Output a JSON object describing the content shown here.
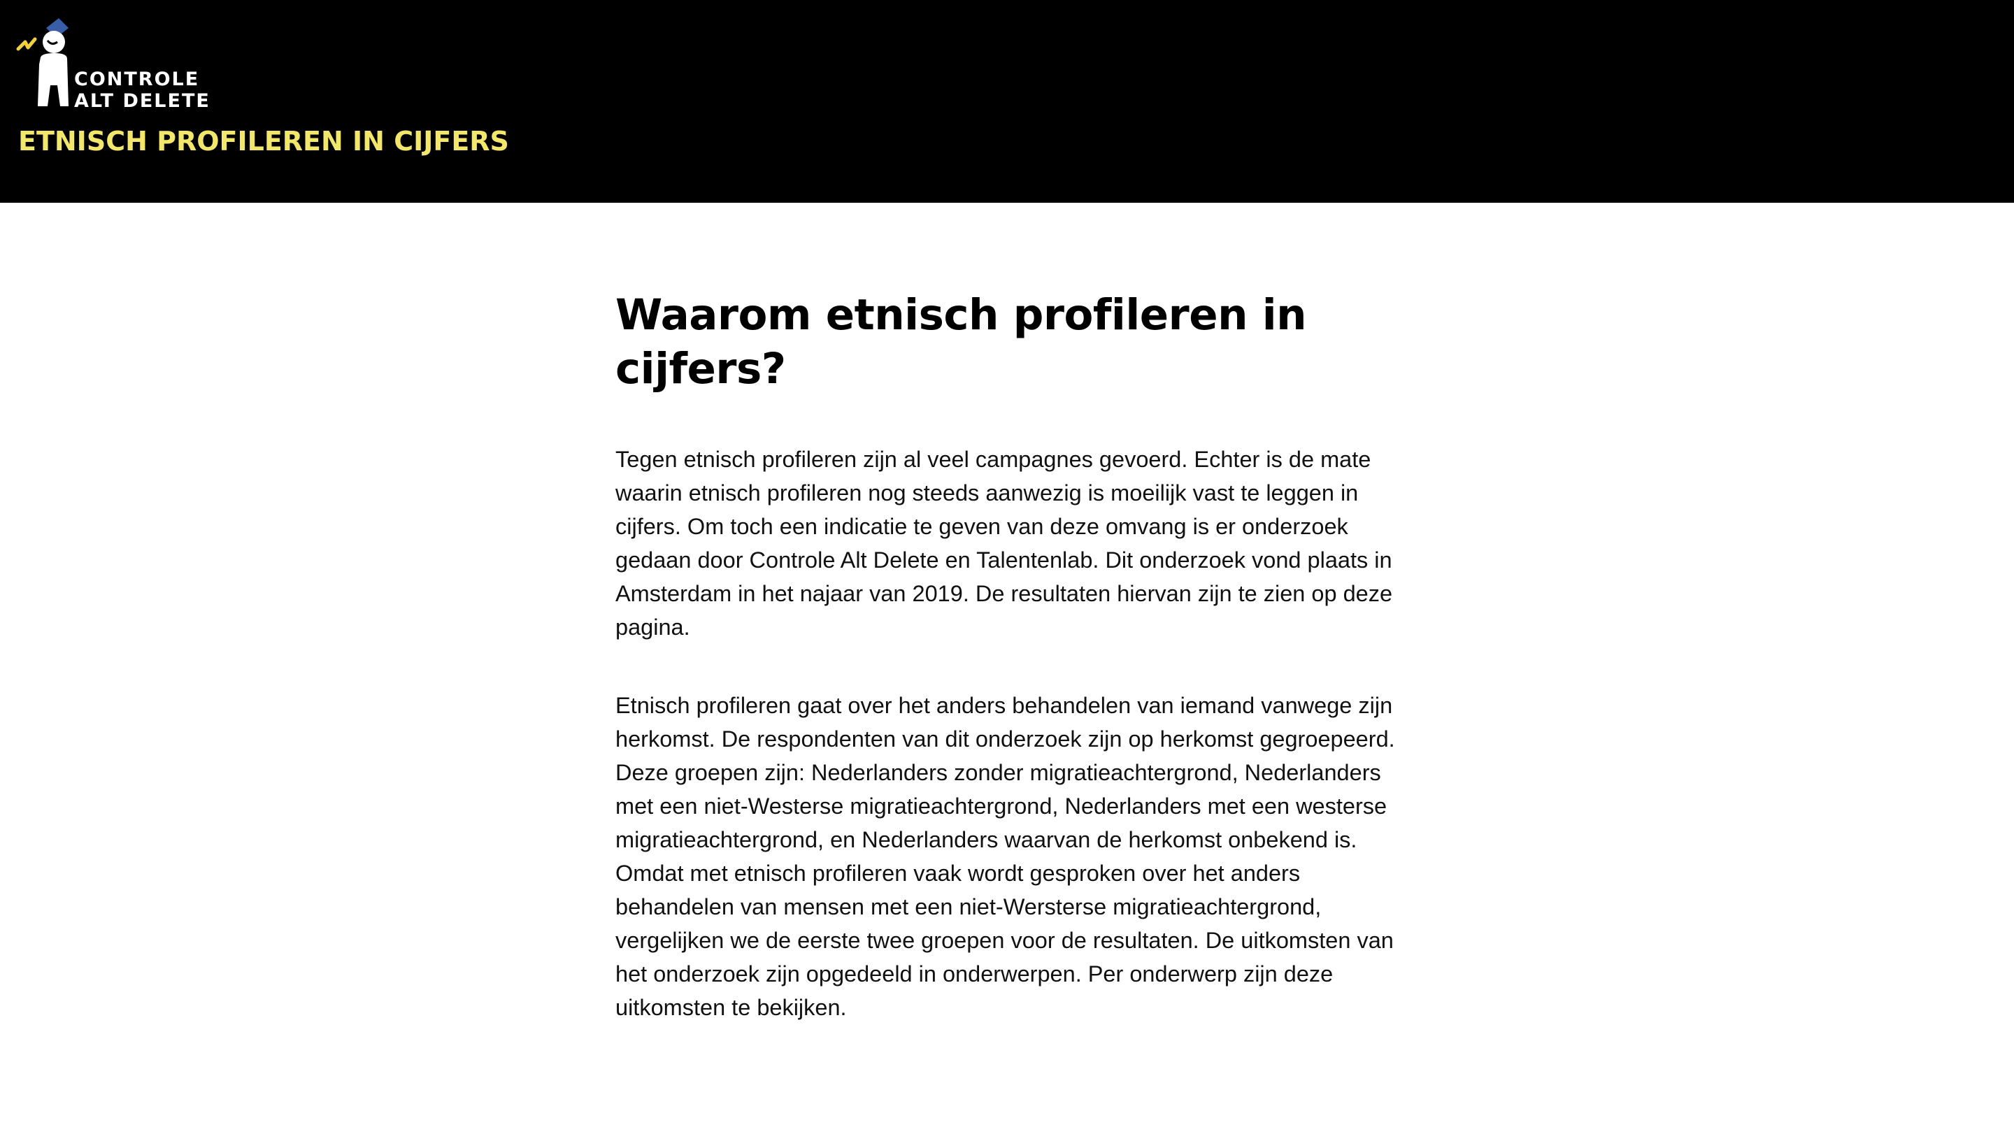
{
  "header": {
    "logo": {
      "line1": "CONTROLE",
      "line2": "ALT DELETE",
      "icon": "police-officer-figure-icon"
    },
    "site_title": "ETNISCH PROFILEREN IN CIJFERS"
  },
  "main": {
    "heading": "Waarom etnisch profileren in cijfers?",
    "paragraphs": [
      "Tegen etnisch profileren zijn al veel campagnes gevoerd. Echter is de mate waarin etnisch profileren nog steeds aanwezig is moeilijk vast te leggen in cijfers. Om toch een indicatie te geven van deze omvang is er onderzoek gedaan door Controle Alt Delete en Talentenlab. Dit onderzoek vond plaats in Amsterdam in het najaar van 2019. De resultaten hiervan zijn te zien op deze pagina.",
      "Etnisch profileren gaat over het anders behandelen van iemand vanwege zijn herkomst. De respondenten van dit onderzoek zijn op herkomst gegroepeerd. Deze groepen zijn: Nederlanders zonder migratieachtergrond, Nederlanders met een niet-Westerse migratieachtergrond, Nederlanders met een westerse migratieachtergrond, en Nederlanders waarvan de herkomst onbekend is. Omdat met etnisch profileren vaak wordt gesproken over het anders behandelen van mensen met een niet-Wersterse migratieachtergrond, vergelijken we de eerste twee groepen voor de resultaten. De uitkomsten van het onderzoek zijn opgedeeld in onderwerpen. Per onderwerp zijn deze uitkomsten te bekijken."
    ]
  },
  "colors": {
    "header_background": "#000000",
    "site_title": "#f2e66b",
    "logo_accent": "#f2d13a",
    "logo_cap": "#3a5da8",
    "page_background": "#ffffff",
    "text": "#111111"
  }
}
